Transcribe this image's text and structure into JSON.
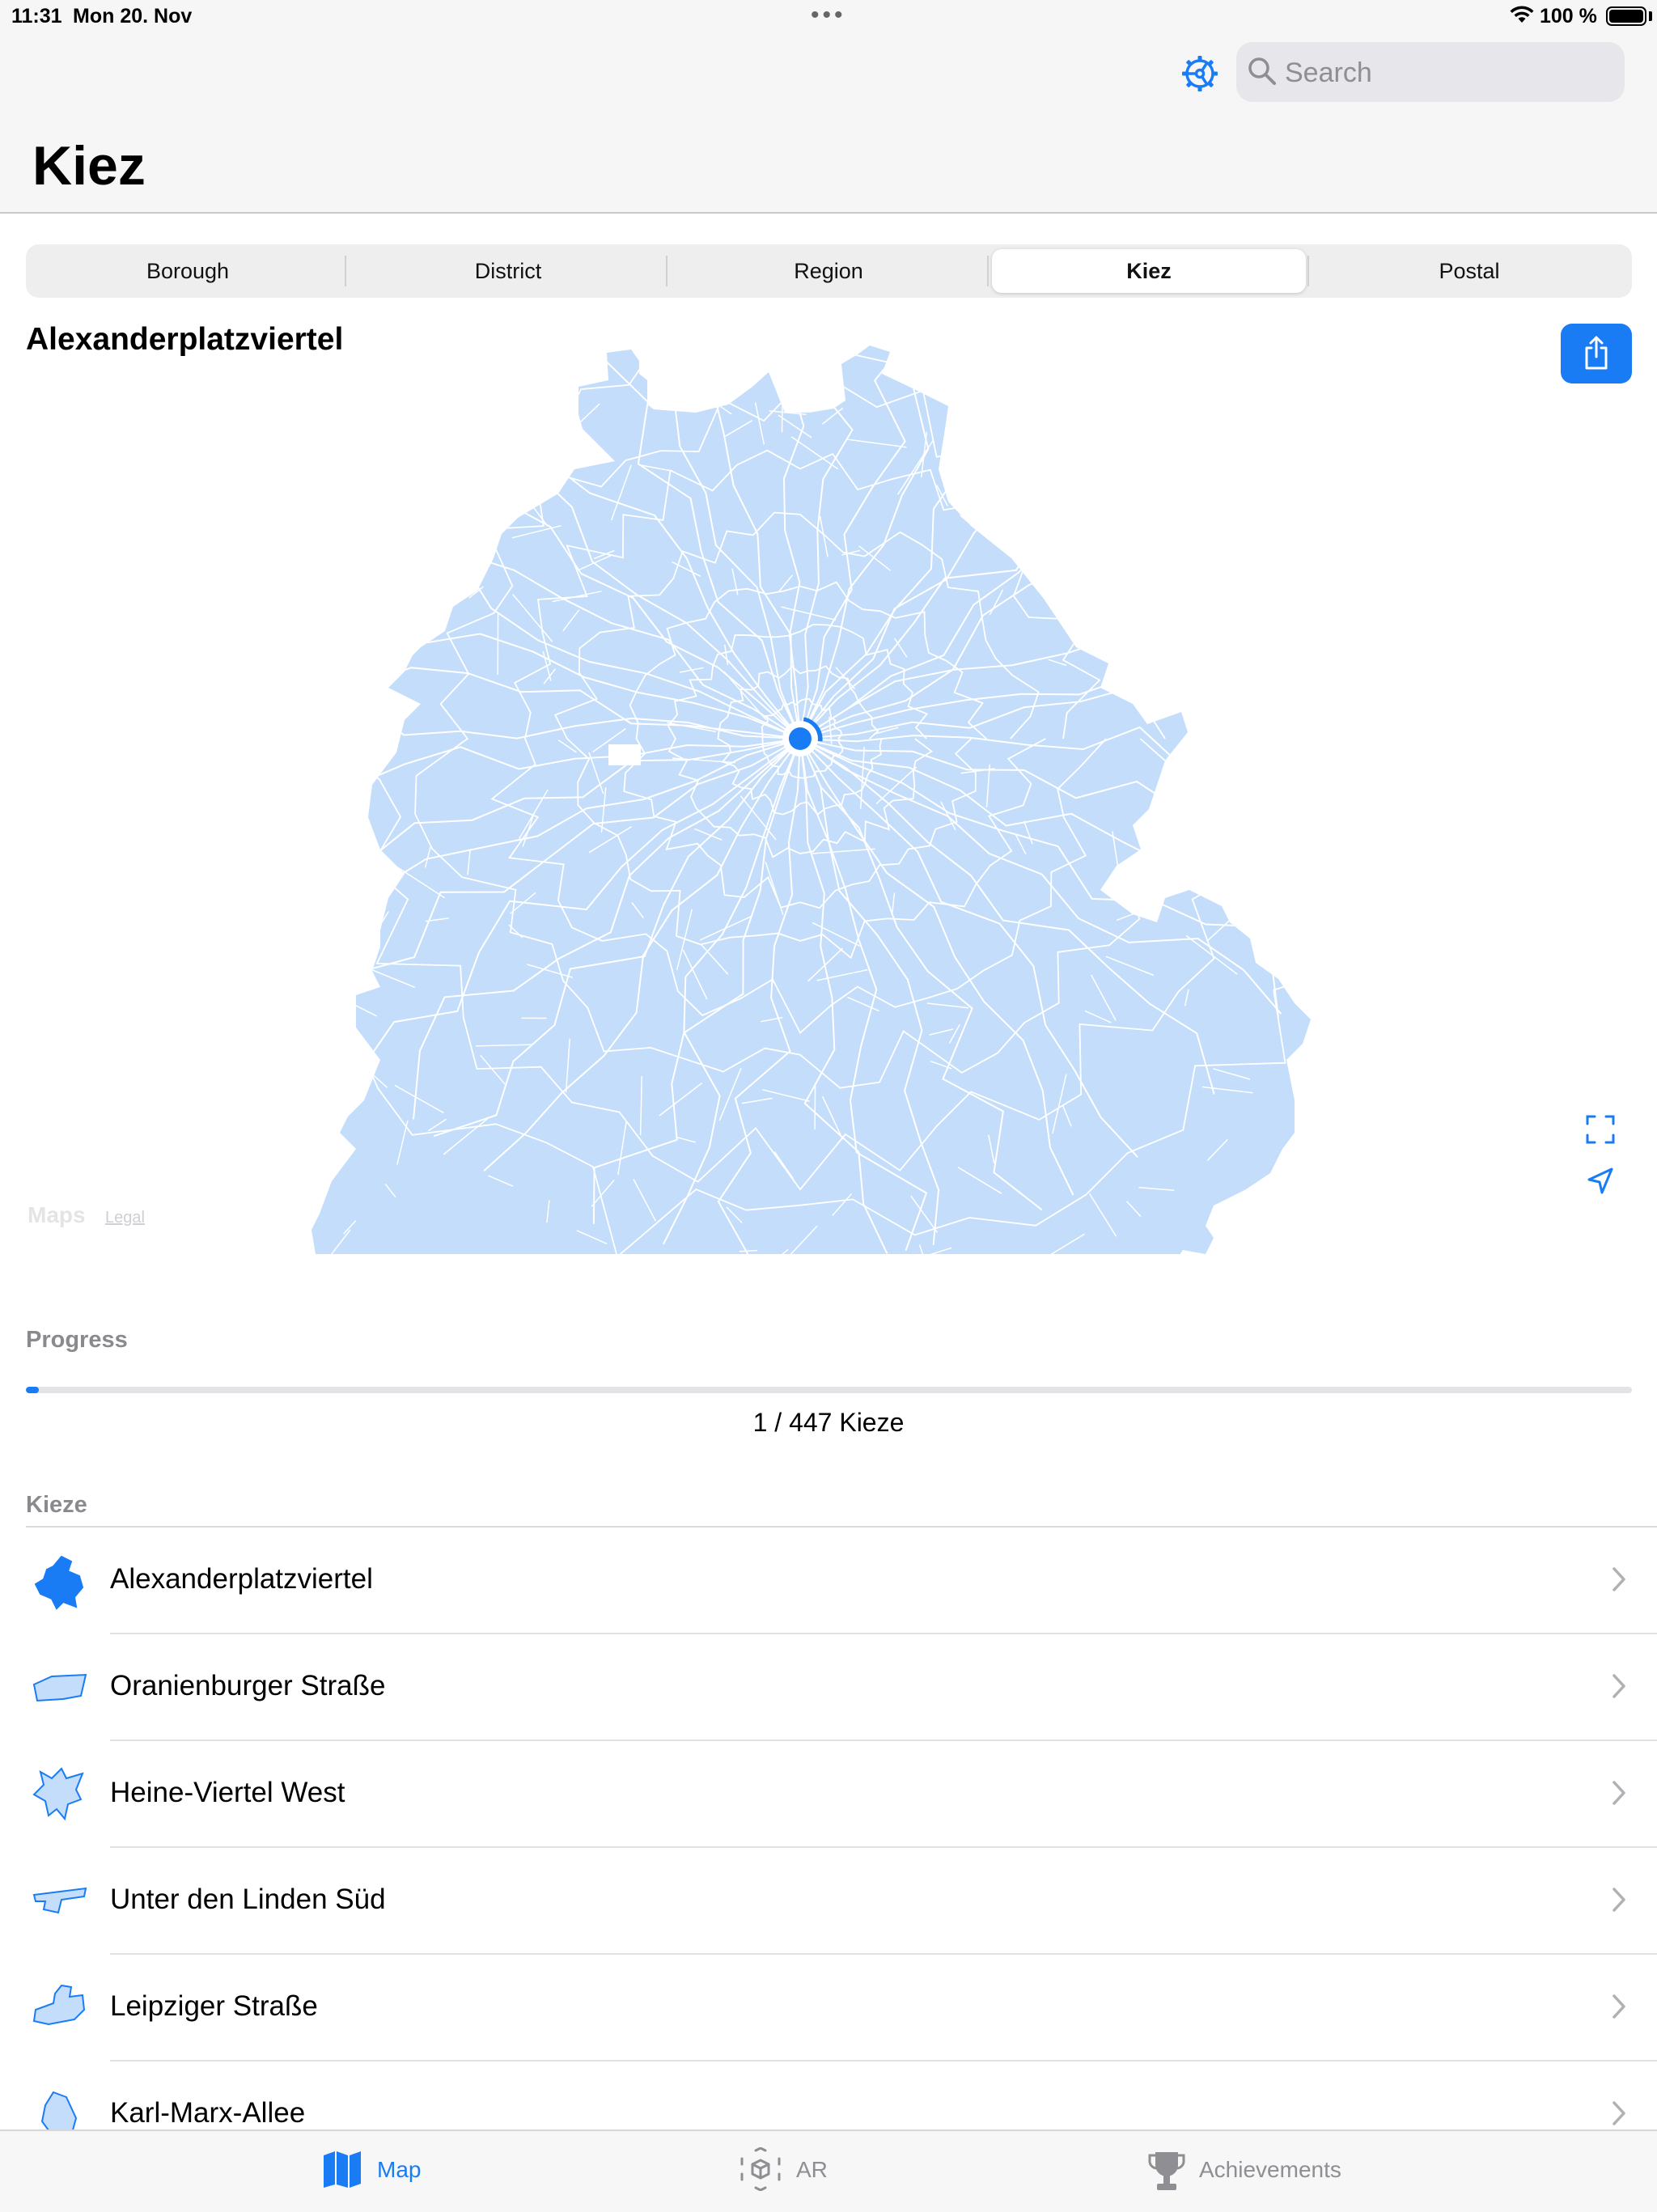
{
  "status": {
    "time": "11:31",
    "date": "Mon 20. Nov",
    "battery": "100 %"
  },
  "header": {
    "title": "Kiez",
    "search_placeholder": "Search"
  },
  "segments": [
    {
      "label": "Borough",
      "selected": false
    },
    {
      "label": "District",
      "selected": false
    },
    {
      "label": "Region",
      "selected": false
    },
    {
      "label": "Kiez",
      "selected": true
    },
    {
      "label": "Postal",
      "selected": false
    }
  ],
  "area": {
    "title": "Alexanderplatzviertel"
  },
  "map": {
    "logo": "Maps",
    "legal": "Legal",
    "fill_color": "#c3ddfa",
    "border_color": "#ffffff",
    "location_color": "#1a7cf5"
  },
  "progress": {
    "label": "Progress",
    "current": 1,
    "total": 447,
    "text": "1 / 447 Kieze"
  },
  "list": {
    "header": "Kieze",
    "items": [
      {
        "name": "Alexanderplatzviertel",
        "highlight": true
      },
      {
        "name": "Oranienburger Straße",
        "highlight": false
      },
      {
        "name": "Heine-Viertel West",
        "highlight": false
      },
      {
        "name": "Unter den Linden Süd",
        "highlight": false
      },
      {
        "name": "Leipziger Straße",
        "highlight": false
      },
      {
        "name": "Karl-Marx-Allee",
        "highlight": false
      }
    ]
  },
  "tabs": [
    {
      "label": "Map",
      "active": true,
      "icon": "map-icon"
    },
    {
      "label": "AR",
      "active": false,
      "icon": "ar-icon"
    },
    {
      "label": "Achievements",
      "active": false,
      "icon": "trophy-icon"
    }
  ],
  "colors": {
    "accent": "#1a7cf5",
    "inactive": "#8e8e93"
  }
}
